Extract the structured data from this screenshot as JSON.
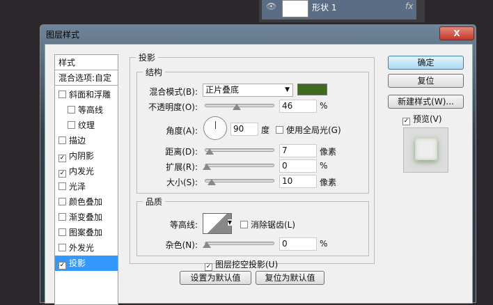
{
  "layers_panel": {
    "layer_name": "形状 1",
    "fx": "fx"
  },
  "dialog": {
    "title": "图层样式",
    "close": "X"
  },
  "sidebar": {
    "header": "样式",
    "blend_options": "混合选项:自定",
    "items": [
      {
        "label": "斜面和浮雕",
        "checked": false,
        "indent": false
      },
      {
        "label": "等高线",
        "checked": false,
        "indent": true
      },
      {
        "label": "纹理",
        "checked": false,
        "indent": true
      },
      {
        "label": "描边",
        "checked": false,
        "indent": false
      },
      {
        "label": "内阴影",
        "checked": true,
        "indent": false
      },
      {
        "label": "内发光",
        "checked": true,
        "indent": false
      },
      {
        "label": "光泽",
        "checked": false,
        "indent": false
      },
      {
        "label": "颜色叠加",
        "checked": false,
        "indent": false
      },
      {
        "label": "渐变叠加",
        "checked": false,
        "indent": false
      },
      {
        "label": "图案叠加",
        "checked": false,
        "indent": false
      },
      {
        "label": "外发光",
        "checked": false,
        "indent": false
      },
      {
        "label": "投影",
        "checked": true,
        "indent": false,
        "selected": true
      }
    ]
  },
  "drop_shadow": {
    "title": "投影",
    "structure": {
      "title": "结构",
      "blend_mode_label": "混合模式(B):",
      "blend_mode": "正片叠底",
      "color": "#3f6b1f",
      "opacity_label": "不透明度(O):",
      "opacity": "46",
      "opacity_unit": "%",
      "angle_label": "角度(A):",
      "angle": "90",
      "angle_unit": "度",
      "global_light": "使用全局光(G)",
      "distance_label": "距离(D):",
      "distance": "7",
      "distance_unit": "像素",
      "spread_label": "扩展(R):",
      "spread": "0",
      "spread_unit": "%",
      "size_label": "大小(S):",
      "size": "10",
      "size_unit": "像素"
    },
    "quality": {
      "title": "品质",
      "contour_label": "等高线:",
      "anti_alias": "消除锯齿(L)",
      "noise_label": "杂色(N):",
      "noise": "0",
      "noise_unit": "%"
    },
    "knockout": "图层挖空投影(U)",
    "make_default": "设置为默认值",
    "reset_default": "复位为默认值"
  },
  "buttons": {
    "ok": "确定",
    "reset": "复位",
    "new_style": "新建样式(W)...",
    "preview": "预览(V)"
  }
}
